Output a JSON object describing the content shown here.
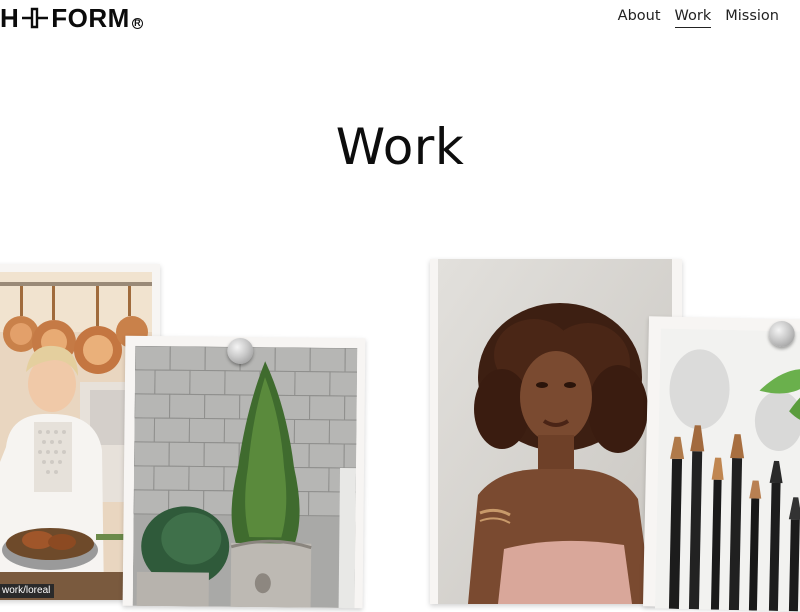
{
  "header": {
    "logo_left": "H",
    "logo_right": "FORM",
    "logo_reg": "R",
    "nav": [
      {
        "label": "About"
      },
      {
        "label": "Work",
        "active": true
      },
      {
        "label": "Mission"
      }
    ]
  },
  "main": {
    "title": "Work"
  },
  "status": {
    "link_preview": "work/loreal"
  },
  "colors": {
    "background": "#ffffff",
    "text": "#0d0d0d",
    "card_frame": "#f7f5f3"
  }
}
